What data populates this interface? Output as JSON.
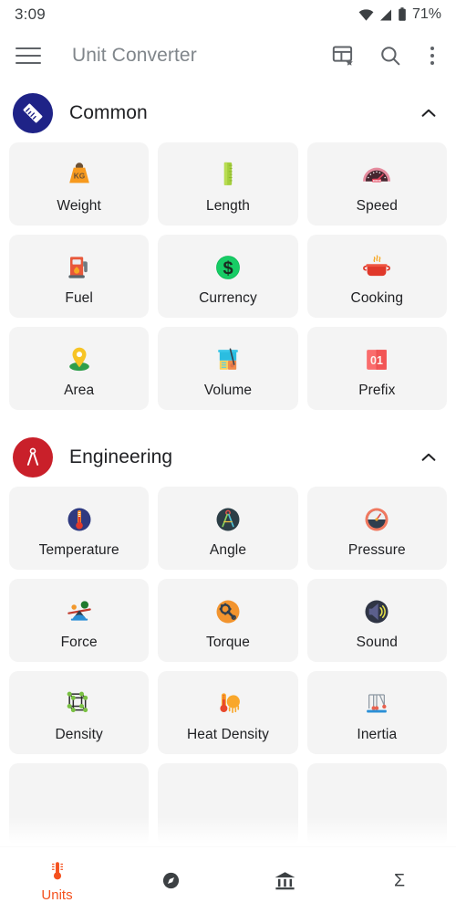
{
  "statusbar": {
    "time": "3:09",
    "battery": "71%",
    "icons": [
      "wifi-icon",
      "cellular-signal-icon",
      "battery-icon"
    ]
  },
  "appbar": {
    "menu_icon": "hamburger-menu-icon",
    "title": "Unit Converter",
    "actions": [
      {
        "name": "favorites-dashboard-icon",
        "label": "Dashboard"
      },
      {
        "name": "search-icon",
        "label": "Search"
      },
      {
        "name": "overflow-menu-icon",
        "label": "More options"
      }
    ]
  },
  "sections": [
    {
      "id": "common",
      "title": "Common",
      "badge_icon": "ruler-icon",
      "badge_color": "#1f2387",
      "expanded": true,
      "chevron": "chevron-up-icon",
      "items": [
        {
          "label": "Weight",
          "icon": "weight-kg-icon"
        },
        {
          "label": "Length",
          "icon": "ruler-vertical-icon"
        },
        {
          "label": "Speed",
          "icon": "speedometer-icon"
        },
        {
          "label": "Fuel",
          "icon": "fuel-pump-icon"
        },
        {
          "label": "Currency",
          "icon": "dollar-coin-icon"
        },
        {
          "label": "Cooking",
          "icon": "cooking-pot-icon"
        },
        {
          "label": "Area",
          "icon": "map-pin-icon"
        },
        {
          "label": "Volume",
          "icon": "beaker-icon"
        },
        {
          "label": "Prefix",
          "icon": "flip-number-01-icon"
        }
      ]
    },
    {
      "id": "engineering",
      "title": "Engineering",
      "badge_icon": "compass-divider-icon",
      "badge_color": "#c9202a",
      "expanded": true,
      "chevron": "chevron-up-icon",
      "items": [
        {
          "label": "Temperature",
          "icon": "thermometer-circle-icon"
        },
        {
          "label": "Angle",
          "icon": "protractor-compass-icon"
        },
        {
          "label": "Pressure",
          "icon": "pressure-gauge-icon"
        },
        {
          "label": "Force",
          "icon": "seesaw-balance-icon"
        },
        {
          "label": "Torque",
          "icon": "wrench-gear-icon"
        },
        {
          "label": "Sound",
          "icon": "speaker-sound-icon"
        },
        {
          "label": "Density",
          "icon": "molecule-cube-icon"
        },
        {
          "label": "Heat Density",
          "icon": "thermometer-sun-icon"
        },
        {
          "label": "Inertia",
          "icon": "newtons-cradle-icon"
        }
      ]
    }
  ],
  "bottomnav": {
    "active_color": "#f4511e",
    "inactive_color": "#3c4043",
    "items": [
      {
        "label": "Units",
        "icon": "thermometer-icon",
        "active": true
      },
      {
        "label": "",
        "icon": "compass-icon",
        "active": false
      },
      {
        "label": "",
        "icon": "bank-icon",
        "active": false
      },
      {
        "label": "",
        "icon": "sigma-icon",
        "active": false
      }
    ]
  }
}
